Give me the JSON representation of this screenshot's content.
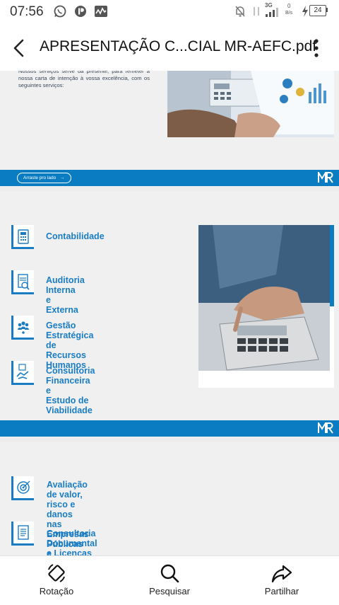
{
  "status_bar": {
    "time": "07:56",
    "network": "3G",
    "speed_value": "0",
    "speed_unit": "B/s",
    "battery": "24"
  },
  "app_bar": {
    "title": "APRESENTAÇÃO C...CIAL MR-AEFC.pdf"
  },
  "document": {
    "intro_text": "Nossos serviços serve da presente, para remeter a nossa carta de intenção à vossa excelência, com os seguintes serviços:",
    "nav_hint": "Arraste pro lado",
    "logo_text": "MR",
    "services_page": [
      {
        "label": "Contabilidade",
        "icon": "calculator-icon"
      },
      {
        "label": "Auditoria Interna\ne Externa",
        "icon": "audit-document-icon"
      },
      {
        "label": "Gestão Estratégica de\nRecursos Humanos",
        "icon": "people-group-icon"
      },
      {
        "label": "Consultoria Financeira e\nEstudo de Viabilidade",
        "icon": "handshake-icon"
      }
    ],
    "services_page_2": [
      {
        "label": "Avaliação de valor, risco e danos nas\nEmpresas Públicas e Privadas",
        "icon": "target-icon"
      },
      {
        "label": "Consultoria Documental e Licenças",
        "icon": "document-list-icon"
      }
    ],
    "accent_color": "#0a7cc2"
  },
  "bottom_bar": {
    "rotate_label": "Rotação",
    "search_label": "Pesquisar",
    "share_label": "Partilhar"
  }
}
